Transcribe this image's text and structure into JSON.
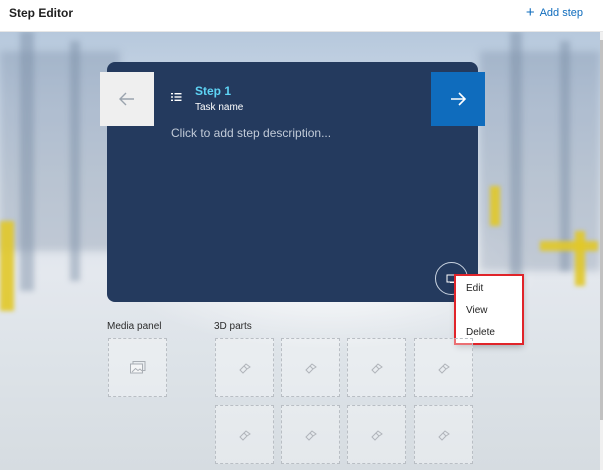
{
  "header": {
    "title": "Step Editor",
    "add_step_icon": "+",
    "add_step_label": "Add step"
  },
  "step": {
    "title": "Step 1",
    "task_name": "Task name",
    "description_placeholder": "Click to add step description..."
  },
  "context_menu": {
    "items": [
      "Edit",
      "View",
      "Delete"
    ]
  },
  "media_panel": {
    "label": "Media panel"
  },
  "parts_panel": {
    "label": "3D parts"
  },
  "colors": {
    "card": "#243a5e",
    "accent": "#0f6cbd",
    "step_title": "#5ed4f5",
    "highlight": "#e0242a"
  },
  "icons": {
    "prev": "arrow-left-icon",
    "next": "arrow-right-icon",
    "list": "list-icon",
    "media": "media-icon",
    "image": "image-icon",
    "part": "3d-part-icon"
  }
}
